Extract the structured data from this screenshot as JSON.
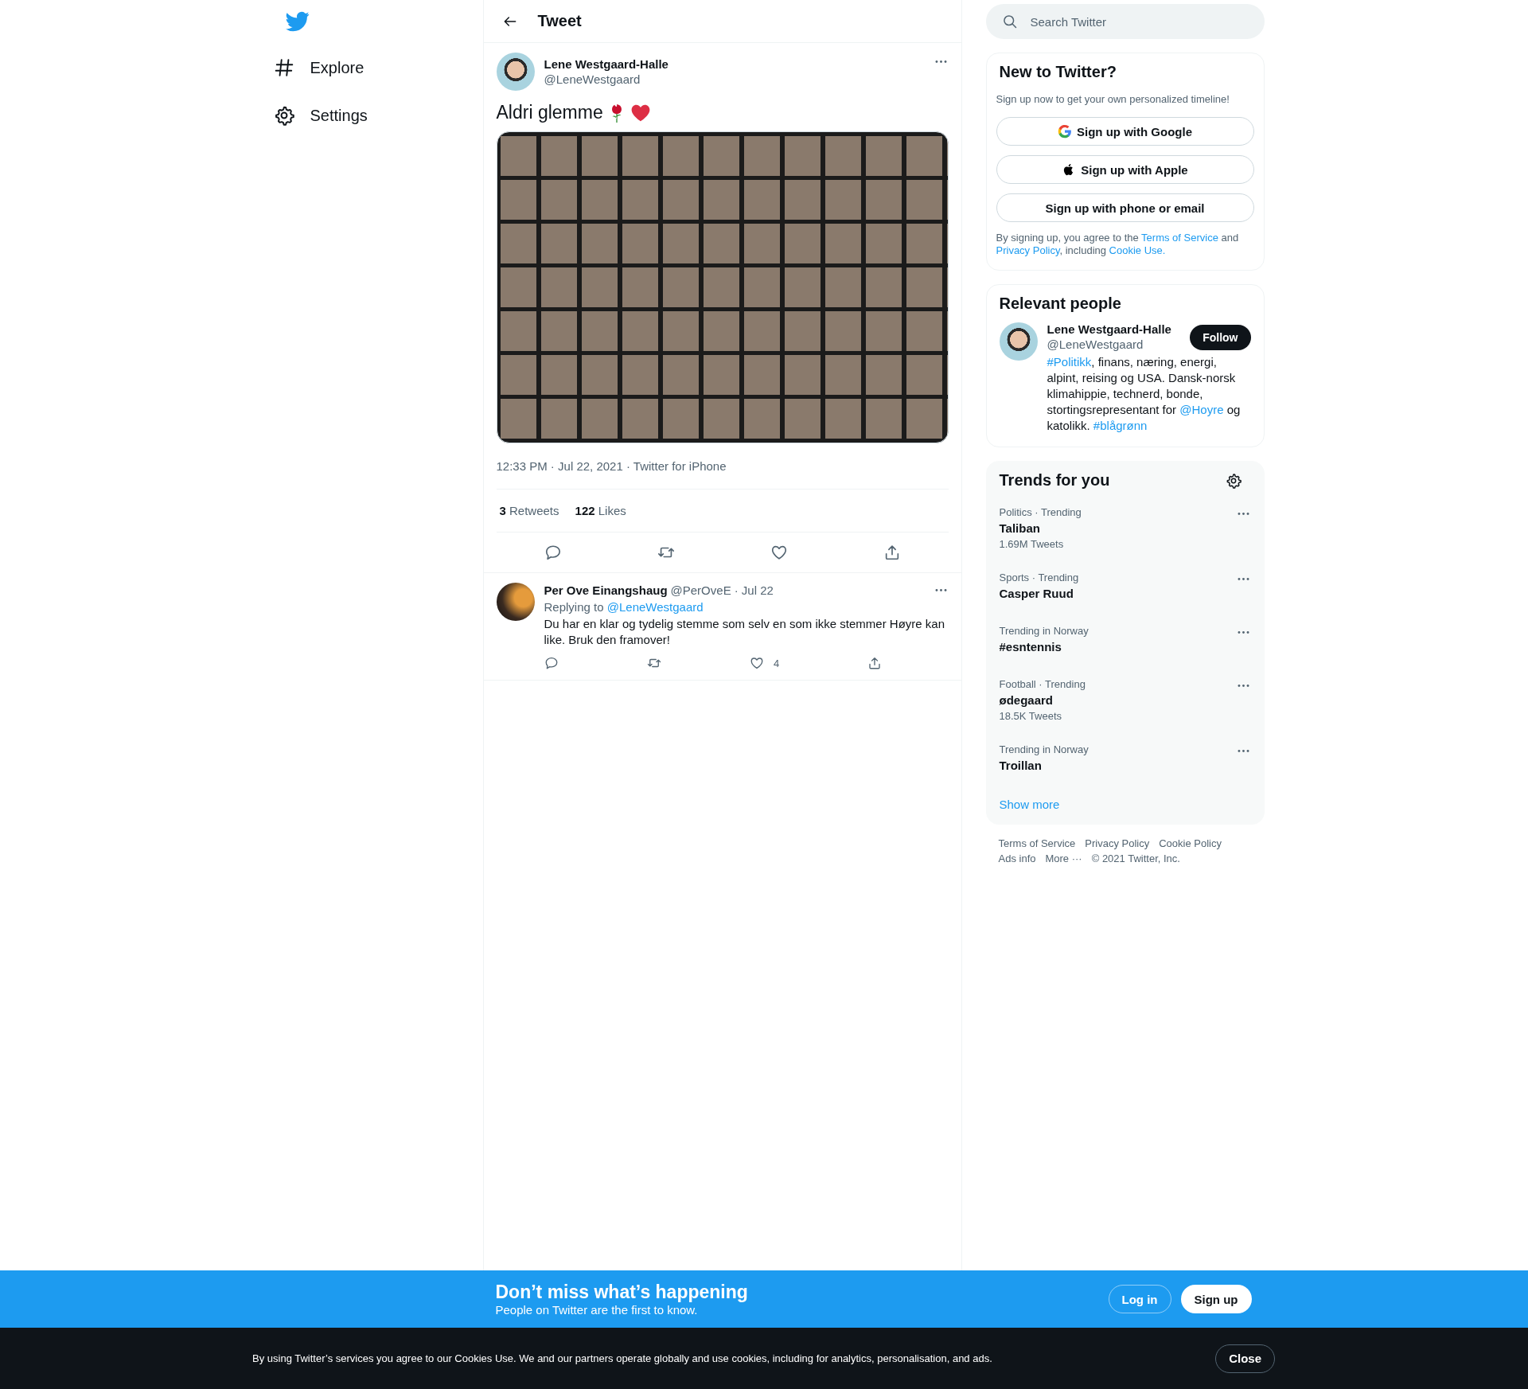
{
  "nav": {
    "items": [
      {
        "label": "Explore"
      },
      {
        "label": "Settings"
      }
    ]
  },
  "header": {
    "title": "Tweet"
  },
  "tweet": {
    "name": "Lene Westgaard-Halle",
    "handle": "@LeneWestgaard",
    "text": "Aldri glemme",
    "meta": "12:33 PM · Jul 22, 2021 · Twitter for iPhone",
    "stats": [
      {
        "count": "3",
        "label": "Retweets"
      },
      {
        "count": "122",
        "label": "Likes"
      }
    ]
  },
  "replies": [
    {
      "name": "Per Ove Einangshaug",
      "handle": "@PerOveE",
      "date": "· Jul 22",
      "replying": [
        {
          "text": "Replying to "
        },
        {
          "text": "@LeneWestgaard",
          "link": true
        }
      ],
      "text": "Du har en klar og tydelig stemme som selv en som ikke stemmer Høyre kan like. Bruk den framover!",
      "likes": "4"
    }
  ],
  "search": {
    "placeholder": "Search Twitter"
  },
  "signup": {
    "title": "New to Twitter?",
    "subtitle": "Sign up now to get your own personalized timeline!",
    "buttons": [
      {
        "kind": "google",
        "label": "Sign up with Google"
      },
      {
        "kind": "apple",
        "label": "Sign up with Apple"
      },
      {
        "kind": "plain",
        "label": "Sign up with phone or email"
      }
    ],
    "legal": [
      {
        "text": "By signing up, you agree to the "
      },
      {
        "text": "Terms of Service",
        "link": true
      },
      {
        "text": " and "
      },
      {
        "text": "Privacy Policy",
        "link": true
      },
      {
        "text": ", including "
      },
      {
        "text": "Cookie Use.",
        "link": true
      }
    ]
  },
  "relevant": {
    "title": "Relevant people",
    "person": {
      "name": "Lene Westgaard-Halle",
      "handle": "@LeneWestgaard",
      "button": "Follow",
      "bio": [
        {
          "text": "#Politikk",
          "link": true
        },
        {
          "text": ", finans, næring, energi, alpint, reising og USA. Dansk-norsk klimahippie, technerd, bonde, stortingsrepresentant for "
        },
        {
          "text": "@Hoyre",
          "link": true
        },
        {
          "text": " og katolikk. "
        },
        {
          "text": "#blågrønn",
          "link": true
        }
      ]
    }
  },
  "trends": {
    "title": "Trends for you",
    "items": [
      {
        "context": "Politics · Trending",
        "name": "Taliban",
        "count": "1.69M Tweets"
      },
      {
        "context": "Sports · Trending",
        "name": "Casper Ruud"
      },
      {
        "context": "Trending in Norway",
        "name": "#esntennis"
      },
      {
        "context": "Football · Trending",
        "name": "ødegaard",
        "count": "18.5K Tweets"
      },
      {
        "context": "Trending in Norway",
        "name": "Troillan"
      }
    ],
    "more": "Show more"
  },
  "footer": {
    "links": [
      "Terms of Service",
      "Privacy Policy",
      "Cookie Policy",
      "Ads info",
      "More ···"
    ],
    "copyright": "© 2021 Twitter, Inc."
  },
  "banner": {
    "title": "Don’t miss what’s happening",
    "subtitle": "People on Twitter are the first to know.",
    "login": "Log in",
    "signup": "Sign up"
  },
  "cookie": {
    "text": "By using Twitter’s services you agree to our Cookies Use. We and our partners operate globally and use cookies, including for analytics, personalisation, and ads.",
    "button": "Close"
  }
}
